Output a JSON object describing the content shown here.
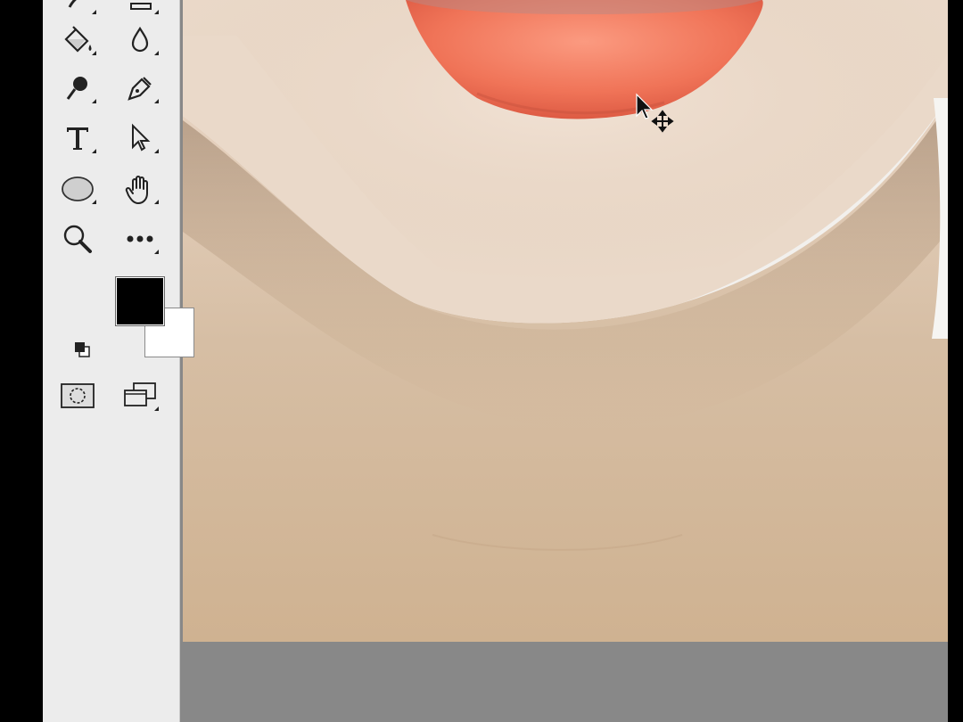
{
  "app": {
    "panel": "tools"
  },
  "tools": [
    {
      "name": "paint-bucket-tool",
      "icon": "paint-bucket-icon"
    },
    {
      "name": "blur-tool",
      "icon": "drop-icon"
    },
    {
      "name": "dodge-tool",
      "icon": "dodge-icon"
    },
    {
      "name": "pen-tool",
      "icon": "pen-icon"
    },
    {
      "name": "type-tool",
      "icon": "type-icon",
      "label": "T"
    },
    {
      "name": "path-selection-tool",
      "icon": "arrow-select-icon"
    },
    {
      "name": "ellipse-tool",
      "icon": "ellipse-icon"
    },
    {
      "name": "hand-tool",
      "icon": "hand-icon"
    },
    {
      "name": "zoom-tool",
      "icon": "zoom-icon"
    },
    {
      "name": "more-tools",
      "icon": "ellipsis-icon"
    }
  ],
  "colors": {
    "foreground": "#000000",
    "background": "#ffffff",
    "toolbar_bg": "#ececec",
    "pasteboard": "#888888",
    "lip": "#f07458"
  },
  "canvas": {
    "cursor": "move-cursor-icon"
  }
}
